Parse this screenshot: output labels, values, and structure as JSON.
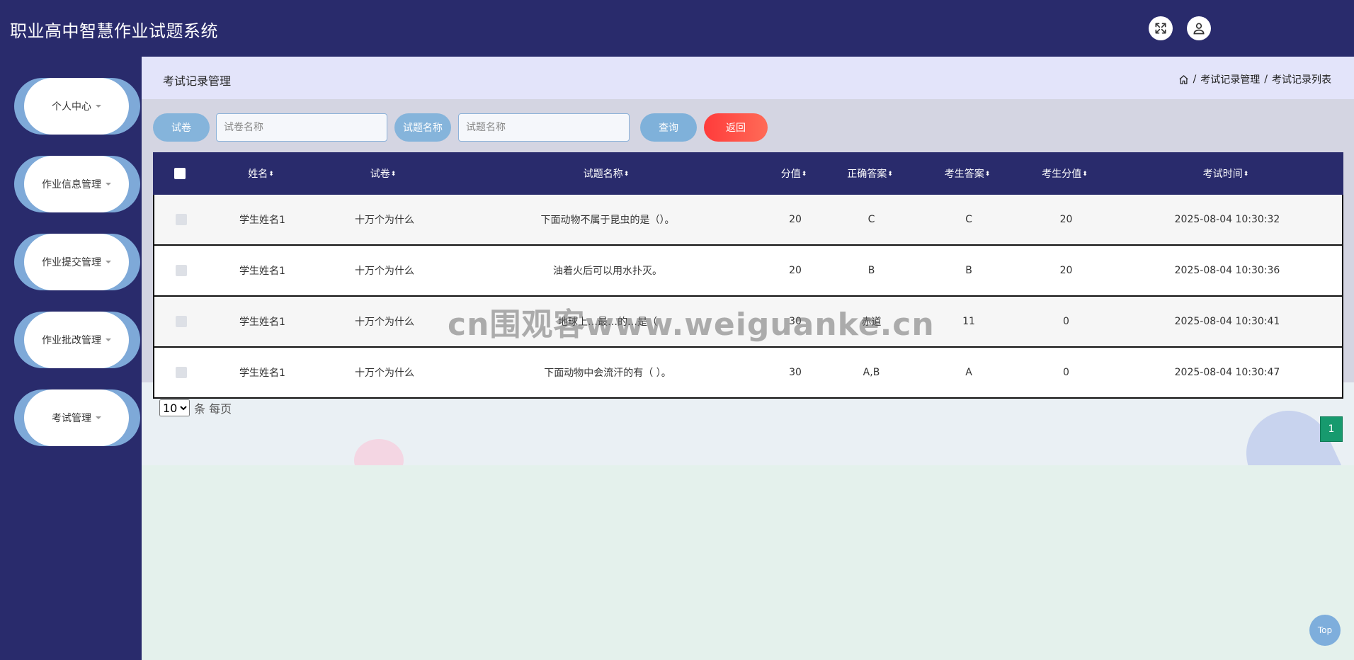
{
  "header": {
    "title": "职业高中智慧作业试题系统",
    "icons": [
      "fullscreen-icon",
      "user-icon"
    ]
  },
  "sidebar": {
    "items": [
      {
        "label": "个人中心"
      },
      {
        "label": "作业信息管理"
      },
      {
        "label": "作业提交管理"
      },
      {
        "label": "作业批改管理"
      },
      {
        "label": "考试管理"
      }
    ]
  },
  "page": {
    "title": "考试记录管理",
    "breadcrumb": [
      "考试记录管理",
      "考试记录列表"
    ],
    "separator": "/"
  },
  "search": {
    "paper_label": "试卷",
    "paper_placeholder": "试卷名称",
    "question_label": "试题名称",
    "question_placeholder": "试题名称",
    "query_button": "查询",
    "back_button": "返回"
  },
  "table": {
    "headers": [
      "姓名",
      "试卷",
      "试题名称",
      "分值",
      "正确答案",
      "考生答案",
      "考生分值",
      "考试时间"
    ],
    "sort_glyph": "⬍",
    "rows": [
      [
        "学生姓名1",
        "十万个为什么",
        "下面动物不属于昆虫的是（）。",
        "20",
        "C",
        "C",
        "20",
        "2025-08-04 10:30:32"
      ],
      [
        "学生姓名1",
        "十万个为什么",
        "油着火后可以用水扑灭。",
        "20",
        "B",
        "B",
        "20",
        "2025-08-04 10:30:36"
      ],
      [
        "学生姓名1",
        "十万个为什么",
        "地球上…最…的…是（",
        "30",
        "赤道",
        "11",
        "0",
        "2025-08-04 10:30:41"
      ],
      [
        "学生姓名1",
        "十万个为什么",
        "下面动物中会流汗的有（ ）。",
        "30",
        "A,B",
        "A",
        "0",
        "2025-08-04 10:30:47"
      ]
    ]
  },
  "pagination": {
    "page_size": "10",
    "page_size_suffix": "条 每页",
    "current_page": "1"
  },
  "top_button": "Top",
  "watermark": "cn围观客www.weiguanke.cn",
  "colors": {
    "header_bg": "#292b6c",
    "pill_blue": "#85b4db",
    "back_red": "#ff4545",
    "page_green": "#179a6e"
  }
}
